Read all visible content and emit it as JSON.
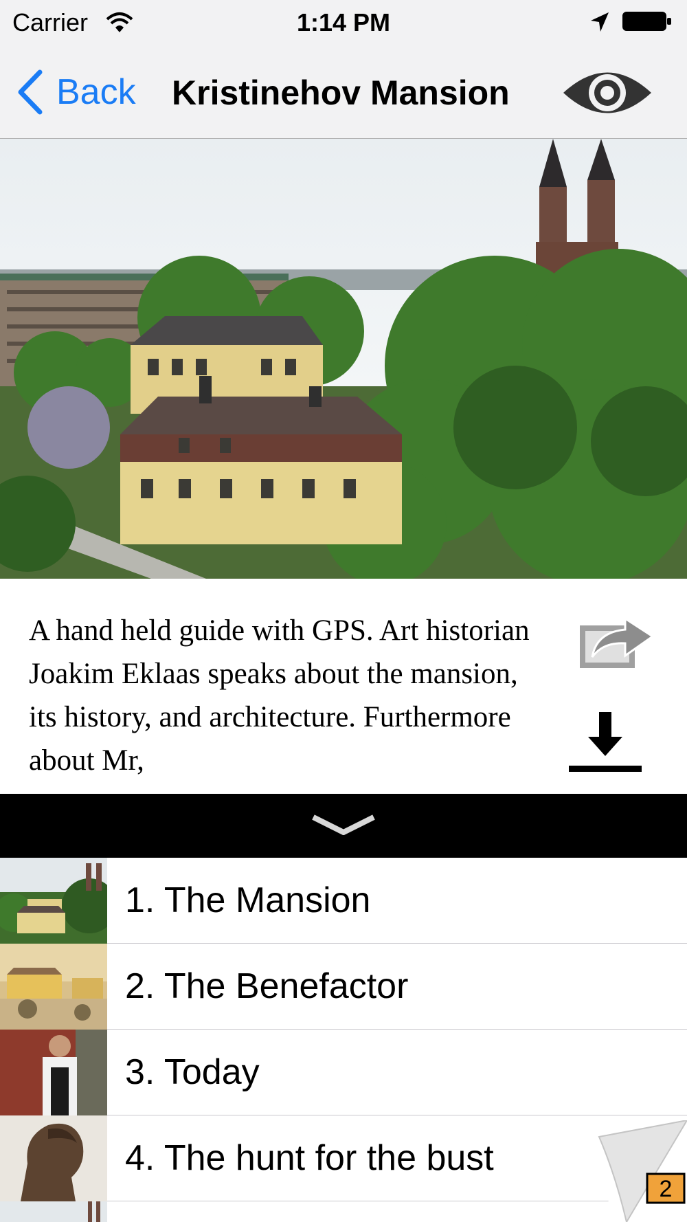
{
  "status_bar": {
    "carrier": "Carrier",
    "time": "1:14 PM"
  },
  "nav": {
    "back_label": "Back",
    "title": "Kristinehov Mansion",
    "accent_color": "#1a7cf5"
  },
  "icons": {
    "wifi": "wifi-icon",
    "location": "location-arrow-icon",
    "battery": "battery-icon",
    "eye": "eye-icon",
    "share": "share-icon",
    "download": "download-icon",
    "expand": "chevron-down-icon"
  },
  "description": {
    "text": "A hand held guide with GPS. Art historian Joakim Eklaas speaks about the mansion, its history, and architecture. Furthermore about Mr,"
  },
  "chapters": [
    {
      "label": "1. The Mansion"
    },
    {
      "label": "2. The Benefactor"
    },
    {
      "label": "3. Today"
    },
    {
      "label": "4. The hunt for the bust"
    }
  ],
  "page_badge": "2"
}
